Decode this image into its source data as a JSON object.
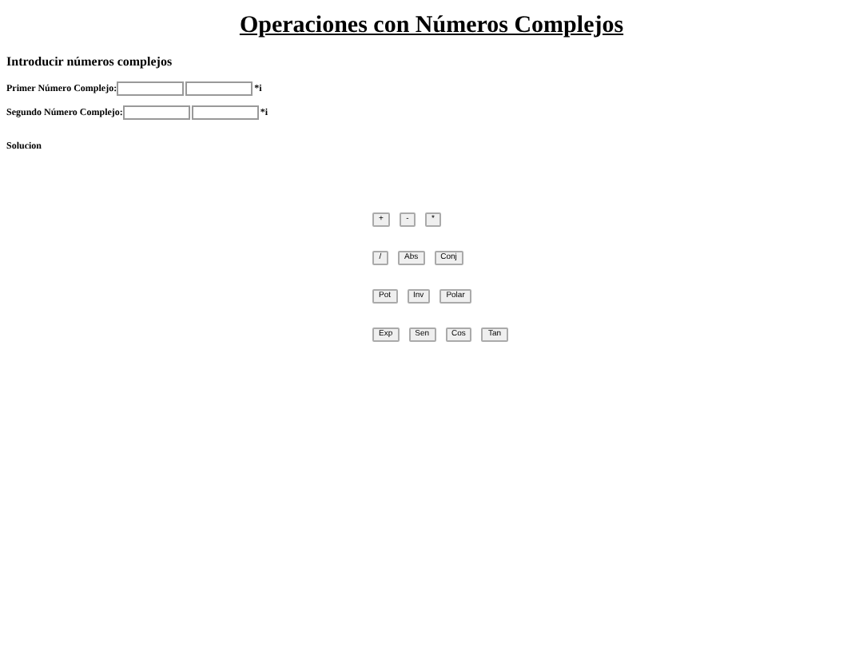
{
  "title": "Operaciones con Números Complejos",
  "section_heading": "Introducir números complejos",
  "inputs": [
    {
      "label": "Primer Número Complejo:",
      "suffix": "*i"
    },
    {
      "label": "Segundo Número Complejo:",
      "suffix": "*i"
    }
  ],
  "solution_label": "Solucion",
  "button_rows": [
    [
      "+",
      "-",
      "*"
    ],
    [
      "/",
      "Abs",
      "Conj"
    ],
    [
      "Pot",
      "Inv",
      "Polar"
    ],
    [
      "Exp",
      "Sen",
      "Cos",
      "Tan"
    ]
  ]
}
